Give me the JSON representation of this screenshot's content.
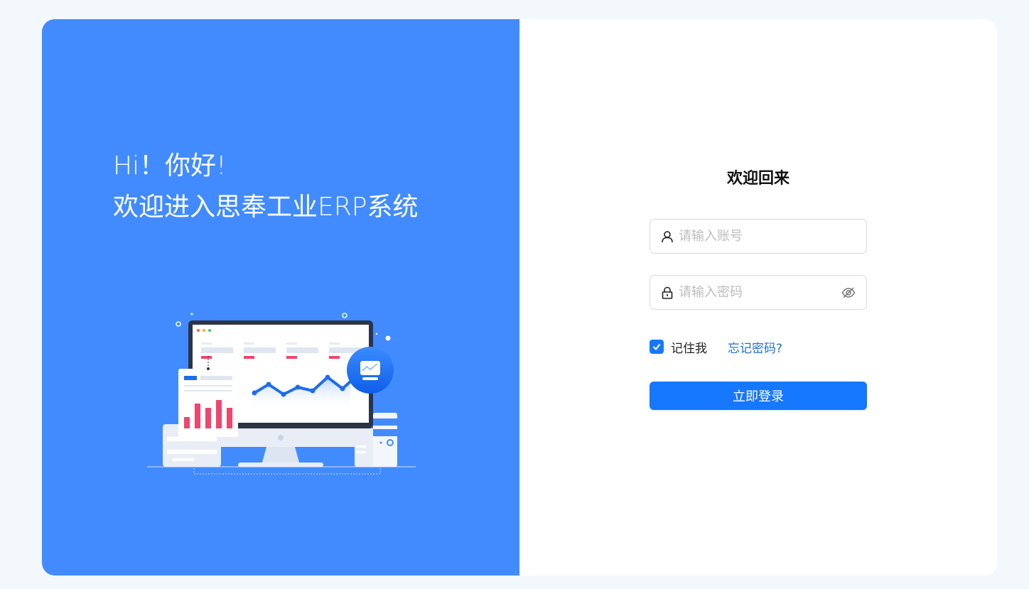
{
  "hero": {
    "line1": "Hi！你好!",
    "line2": "欢迎进入思奉工业ERP系统"
  },
  "login": {
    "title": "欢迎回来",
    "username_placeholder": "请输入账号",
    "password_placeholder": "请输入密码",
    "remember_label": "记住我",
    "remember_checked": true,
    "forgot_label": "忘记密码?",
    "submit_label": "立即登录"
  },
  "colors": {
    "left_panel": "#418bfe",
    "primary": "#1677ff",
    "link": "#1f6fd8",
    "page_bg": "#f3f8fd"
  },
  "icons": [
    "user-icon",
    "lock-icon",
    "eye-off-icon",
    "check-icon"
  ]
}
